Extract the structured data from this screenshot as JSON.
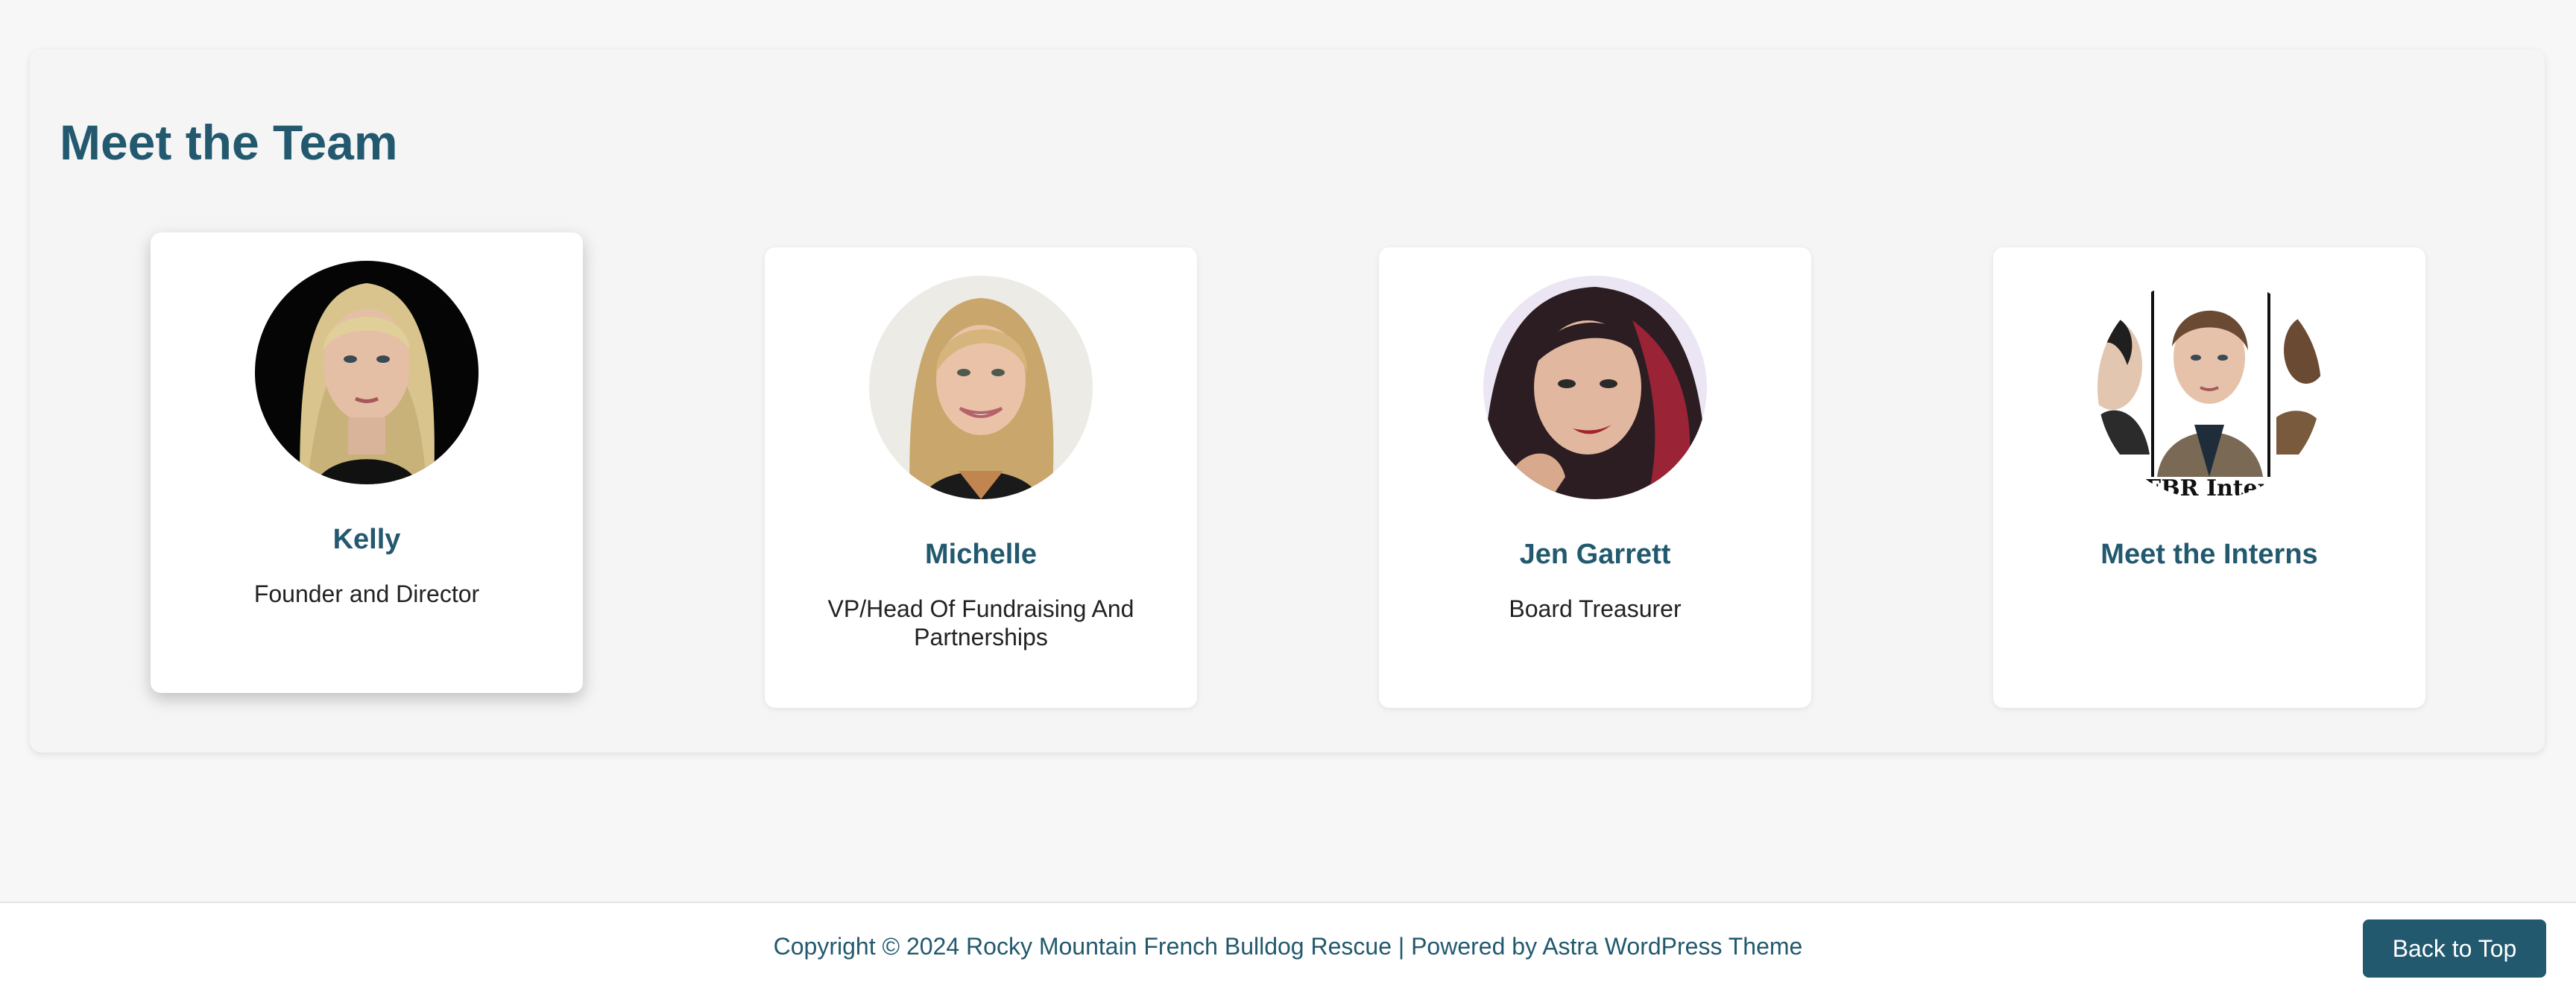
{
  "section": {
    "title": "Meet the Team"
  },
  "team": [
    {
      "name": "Kelly",
      "role": "Founder and Director",
      "photo": "kelly-photo"
    },
    {
      "name": "Michelle",
      "role": "VP/Head Of Fundraising And Partnerships",
      "photo": "michelle-photo"
    },
    {
      "name": "Jen Garrett",
      "role": "Board Treasurer",
      "photo": "jen-garrett-photo"
    },
    {
      "name": "Meet the Interns",
      "role": "",
      "photo": "interns-photo",
      "photo_caption": "MFBR Interns"
    }
  ],
  "footer": {
    "copyright": "Copyright © 2024 Rocky Mountain French Bulldog Rescue | Powered by Astra WordPress Theme",
    "back_to_top": "Back to Top"
  },
  "colors": {
    "accent": "#22596e",
    "page_background": "#f7f7f7",
    "card_background": "#ffffff"
  }
}
